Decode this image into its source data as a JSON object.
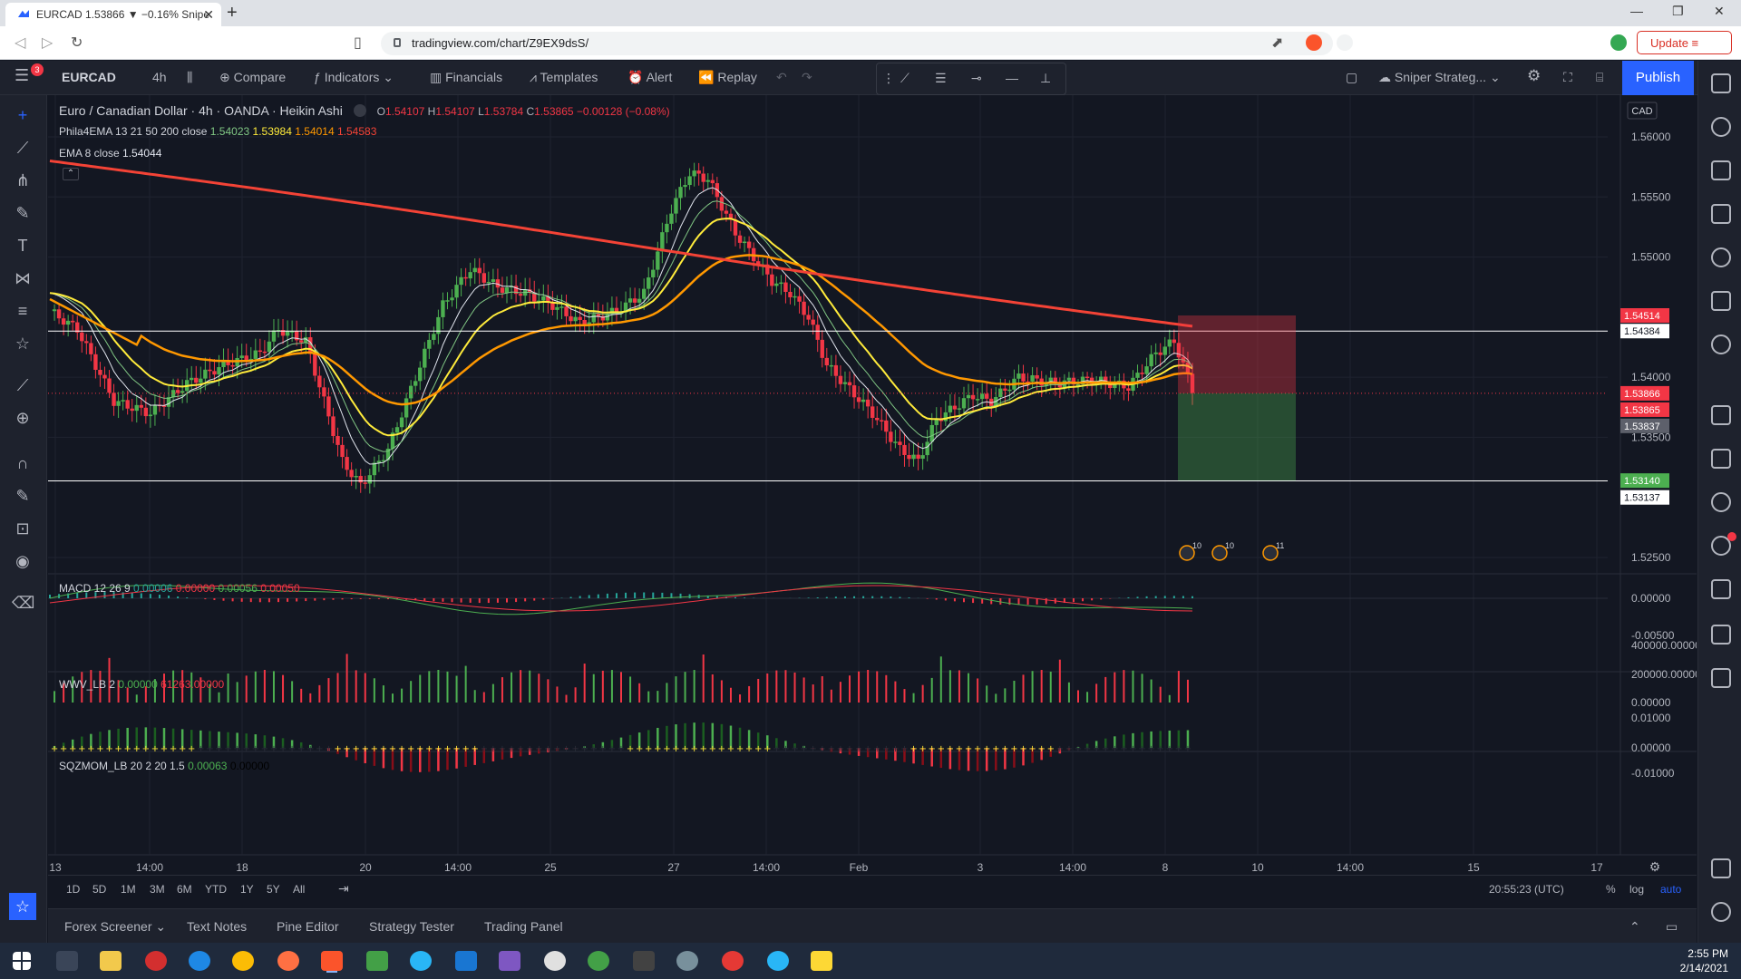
{
  "browser": {
    "tab_title": "EURCAD 1.53866 ▼ −0.16% Snipe",
    "url": "tradingview.com/chart/Z9EX9dsS/",
    "update_label": "Update"
  },
  "toolbar": {
    "badge": "3",
    "symbol": "EURCAD",
    "interval": "4h",
    "compare": "Compare",
    "indicators": "Indicators",
    "financials": "Financials",
    "templates": "Templates",
    "alert": "Alert",
    "replay": "Replay",
    "layout_name": "Sniper Strateg...",
    "publish": "Publish"
  },
  "legend": {
    "title": "Euro / Canadian Dollar · 4h · OANDA · Heikin Ashi",
    "o_label": "O",
    "o": "1.54107",
    "h_label": "H",
    "h": "1.54107",
    "l_label": "L",
    "l": "1.53784",
    "c_label": "C",
    "c": "1.53865",
    "change": "−0.00128 (−0.08%)",
    "ema4_name": "Phila4EMA 13 21 50 200 close",
    "ema4_v1": "1.54023",
    "ema4_v2": "1.53984",
    "ema4_v3": "1.54014",
    "ema4_v4": "1.54583",
    "ema8_name": "EMA 8 close",
    "ema8_v": "1.54044",
    "macd_name": "MACD 12 26 9",
    "macd_v1": "0.00006",
    "macd_v2": "0.00000",
    "macd_v3": "0.00056",
    "macd_v4": "0.00050",
    "wwv_name": "WWV_LB 2",
    "wwv_v1": "0.00000",
    "wwv_v2": "61263.00000",
    "sqz_name": "SQZMOM_LB 20 2 20 1.5",
    "sqz_v1": "0.00063",
    "sqz_v2": "0.00000",
    "currency": "CAD"
  },
  "price_axis": {
    "ticks": [
      "1.56000",
      "1.55500",
      "1.55000",
      "1.54000",
      "1.53500",
      "1.52500"
    ],
    "tag_stop": "1.54514",
    "tag_line_upper": "1.54384",
    "tag_entry": "1.53866",
    "tag_last": "1.53865",
    "tag_cursor": "1.53837",
    "tag_target": "1.53140",
    "tag_line_lower": "1.53137",
    "macd_ticks": [
      "0.00000",
      "-0.00500"
    ],
    "wwv_ticks": [
      "400000.00000",
      "200000.00000",
      "0.00000"
    ],
    "sqz_ticks": [
      "0.01000",
      "0.00000",
      "-0.01000"
    ]
  },
  "time_axis": {
    "labels": [
      "13",
      "14:00",
      "18",
      "20",
      "14:00",
      "25",
      "27",
      "14:00",
      "Feb",
      "3",
      "14:00",
      "8",
      "10",
      "14:00",
      "15",
      "17"
    ]
  },
  "events": [
    "10",
    "10",
    "11"
  ],
  "range_bar": {
    "ranges": [
      "1D",
      "5D",
      "1M",
      "3M",
      "6M",
      "YTD",
      "1Y",
      "5Y",
      "All"
    ],
    "time": "20:55:23 (UTC)",
    "percent": "%",
    "log": "log",
    "auto": "auto"
  },
  "bottom_tabs": [
    "Forex Screener",
    "Text Notes",
    "Pine Editor",
    "Strategy Tester",
    "Trading Panel"
  ],
  "taskbar": {
    "time": "2:55 PM",
    "date": "2/14/2021"
  },
  "colors": {
    "up": "#26a69a",
    "candle_up": "#4caf50",
    "candle_down": "#f23645",
    "ema200": "#f44336",
    "ema50": "#ff9800",
    "ema21": "#ffeb3b",
    "ema13": "#81c784",
    "ema8": "#e1e5ee",
    "accent": "#2962ff"
  }
}
